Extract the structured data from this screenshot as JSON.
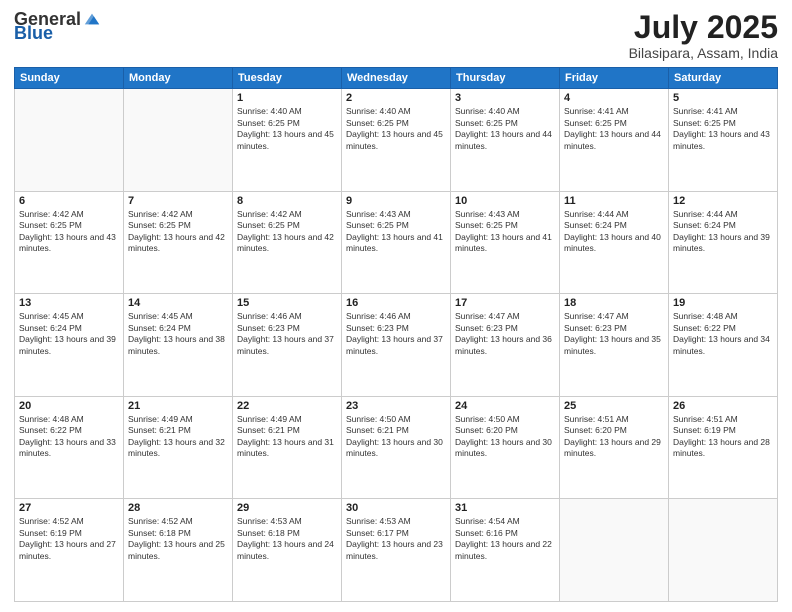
{
  "header": {
    "logo_general": "General",
    "logo_blue": "Blue",
    "title": "July 2025",
    "location": "Bilasipara, Assam, India"
  },
  "days_of_week": [
    "Sunday",
    "Monday",
    "Tuesday",
    "Wednesday",
    "Thursday",
    "Friday",
    "Saturday"
  ],
  "weeks": [
    [
      {
        "day": "",
        "info": ""
      },
      {
        "day": "",
        "info": ""
      },
      {
        "day": "1",
        "sunrise": "4:40 AM",
        "sunset": "6:25 PM",
        "daylight": "13 hours and 45 minutes."
      },
      {
        "day": "2",
        "sunrise": "4:40 AM",
        "sunset": "6:25 PM",
        "daylight": "13 hours and 45 minutes."
      },
      {
        "day": "3",
        "sunrise": "4:40 AM",
        "sunset": "6:25 PM",
        "daylight": "13 hours and 44 minutes."
      },
      {
        "day": "4",
        "sunrise": "4:41 AM",
        "sunset": "6:25 PM",
        "daylight": "13 hours and 44 minutes."
      },
      {
        "day": "5",
        "sunrise": "4:41 AM",
        "sunset": "6:25 PM",
        "daylight": "13 hours and 43 minutes."
      }
    ],
    [
      {
        "day": "6",
        "sunrise": "4:42 AM",
        "sunset": "6:25 PM",
        "daylight": "13 hours and 43 minutes."
      },
      {
        "day": "7",
        "sunrise": "4:42 AM",
        "sunset": "6:25 PM",
        "daylight": "13 hours and 42 minutes."
      },
      {
        "day": "8",
        "sunrise": "4:42 AM",
        "sunset": "6:25 PM",
        "daylight": "13 hours and 42 minutes."
      },
      {
        "day": "9",
        "sunrise": "4:43 AM",
        "sunset": "6:25 PM",
        "daylight": "13 hours and 41 minutes."
      },
      {
        "day": "10",
        "sunrise": "4:43 AM",
        "sunset": "6:25 PM",
        "daylight": "13 hours and 41 minutes."
      },
      {
        "day": "11",
        "sunrise": "4:44 AM",
        "sunset": "6:24 PM",
        "daylight": "13 hours and 40 minutes."
      },
      {
        "day": "12",
        "sunrise": "4:44 AM",
        "sunset": "6:24 PM",
        "daylight": "13 hours and 39 minutes."
      }
    ],
    [
      {
        "day": "13",
        "sunrise": "4:45 AM",
        "sunset": "6:24 PM",
        "daylight": "13 hours and 39 minutes."
      },
      {
        "day": "14",
        "sunrise": "4:45 AM",
        "sunset": "6:24 PM",
        "daylight": "13 hours and 38 minutes."
      },
      {
        "day": "15",
        "sunrise": "4:46 AM",
        "sunset": "6:23 PM",
        "daylight": "13 hours and 37 minutes."
      },
      {
        "day": "16",
        "sunrise": "4:46 AM",
        "sunset": "6:23 PM",
        "daylight": "13 hours and 37 minutes."
      },
      {
        "day": "17",
        "sunrise": "4:47 AM",
        "sunset": "6:23 PM",
        "daylight": "13 hours and 36 minutes."
      },
      {
        "day": "18",
        "sunrise": "4:47 AM",
        "sunset": "6:23 PM",
        "daylight": "13 hours and 35 minutes."
      },
      {
        "day": "19",
        "sunrise": "4:48 AM",
        "sunset": "6:22 PM",
        "daylight": "13 hours and 34 minutes."
      }
    ],
    [
      {
        "day": "20",
        "sunrise": "4:48 AM",
        "sunset": "6:22 PM",
        "daylight": "13 hours and 33 minutes."
      },
      {
        "day": "21",
        "sunrise": "4:49 AM",
        "sunset": "6:21 PM",
        "daylight": "13 hours and 32 minutes."
      },
      {
        "day": "22",
        "sunrise": "4:49 AM",
        "sunset": "6:21 PM",
        "daylight": "13 hours and 31 minutes."
      },
      {
        "day": "23",
        "sunrise": "4:50 AM",
        "sunset": "6:21 PM",
        "daylight": "13 hours and 30 minutes."
      },
      {
        "day": "24",
        "sunrise": "4:50 AM",
        "sunset": "6:20 PM",
        "daylight": "13 hours and 30 minutes."
      },
      {
        "day": "25",
        "sunrise": "4:51 AM",
        "sunset": "6:20 PM",
        "daylight": "13 hours and 29 minutes."
      },
      {
        "day": "26",
        "sunrise": "4:51 AM",
        "sunset": "6:19 PM",
        "daylight": "13 hours and 28 minutes."
      }
    ],
    [
      {
        "day": "27",
        "sunrise": "4:52 AM",
        "sunset": "6:19 PM",
        "daylight": "13 hours and 27 minutes."
      },
      {
        "day": "28",
        "sunrise": "4:52 AM",
        "sunset": "6:18 PM",
        "daylight": "13 hours and 25 minutes."
      },
      {
        "day": "29",
        "sunrise": "4:53 AM",
        "sunset": "6:18 PM",
        "daylight": "13 hours and 24 minutes."
      },
      {
        "day": "30",
        "sunrise": "4:53 AM",
        "sunset": "6:17 PM",
        "daylight": "13 hours and 23 minutes."
      },
      {
        "day": "31",
        "sunrise": "4:54 AM",
        "sunset": "6:16 PM",
        "daylight": "13 hours and 22 minutes."
      },
      {
        "day": "",
        "info": ""
      },
      {
        "day": "",
        "info": ""
      }
    ]
  ]
}
